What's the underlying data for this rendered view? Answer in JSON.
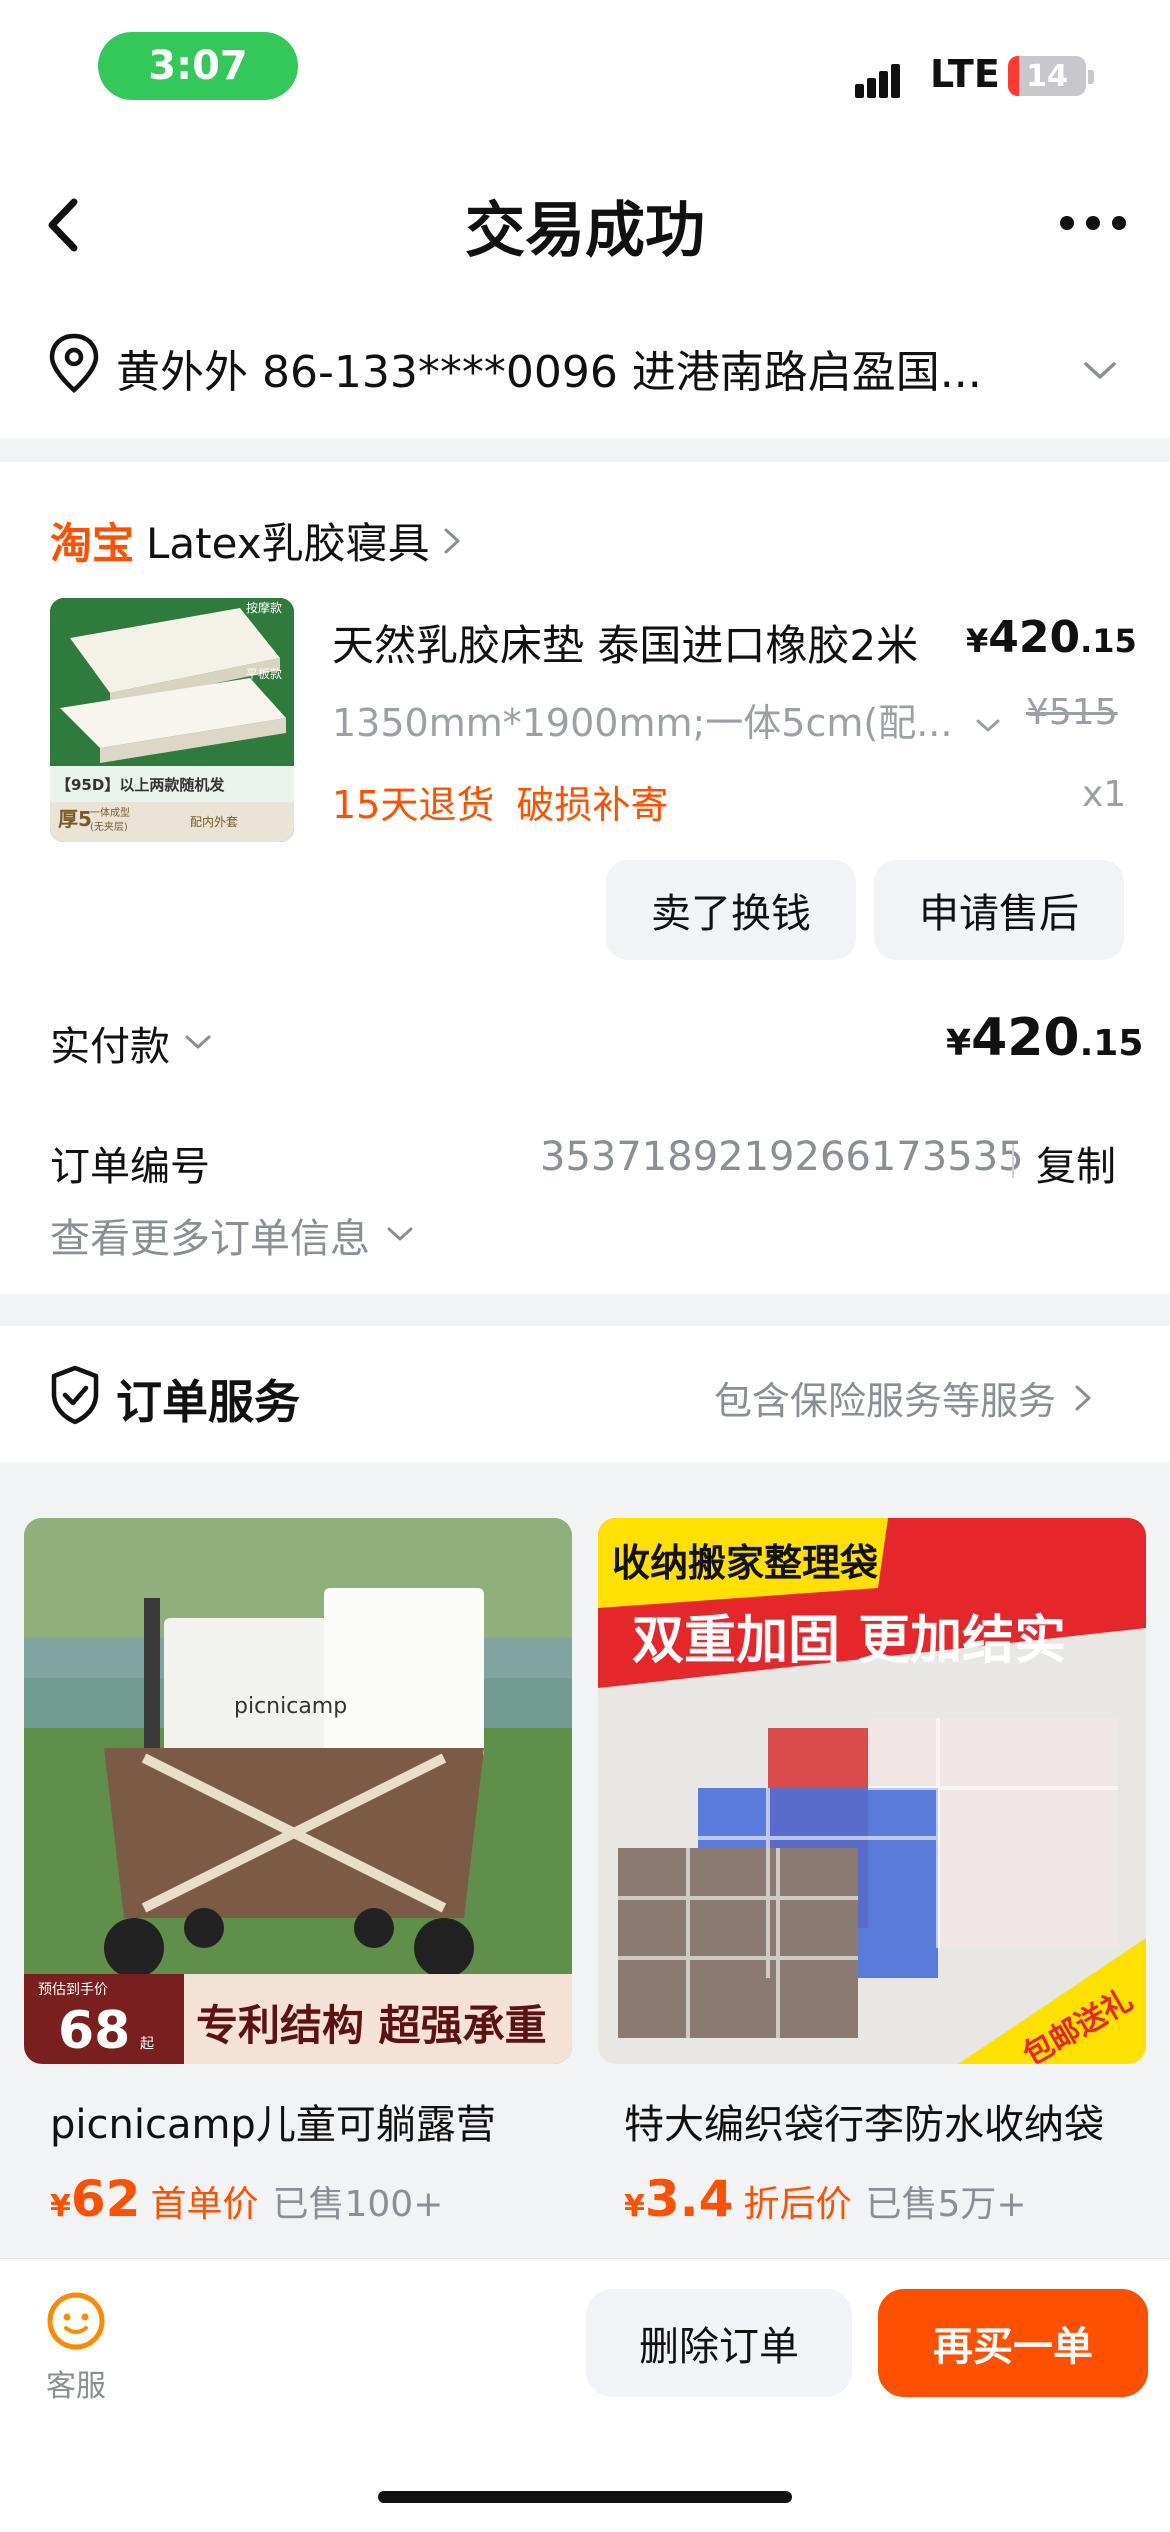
{
  "status": {
    "time": "3:07",
    "network": "LTE",
    "battery": "14",
    "battery_level": 0.14
  },
  "nav": {
    "title": "交易成功"
  },
  "address": {
    "text": "黄外外  86-133****0096  进港南路启盈国..."
  },
  "order": {
    "shop_brand": "淘宝",
    "shop_name": "Latex乳胶寝具",
    "product": {
      "title": "天然乳胶床垫 泰国进口橡胶2米",
      "price_yen": "¥",
      "price_int": "420",
      "price_dec": ".15",
      "spec": "1350mm*1900mm;一体5cm(配...",
      "original_price": "¥515",
      "tags": [
        "15天退货",
        "破损补寄"
      ],
      "qty": "x1",
      "thumb_text": {
        "tag1": "按摩款",
        "tag2": "平板款",
        "banner": "【95D】以上两款随机发",
        "note1": "厚5",
        "note2": "一体成型",
        "note3": "(无夹层)",
        "note4": "配内外套"
      }
    },
    "buttons": {
      "sell": "卖了换钱",
      "after_sale": "申请售后"
    },
    "paid_label": "实付款",
    "paid_yen": "¥",
    "paid_int": "420",
    "paid_dec": ".15",
    "order_no_label": "订单编号",
    "order_no": "3537189219266173535",
    "copy": "复制",
    "more_info": "查看更多订单信息"
  },
  "service": {
    "label": "订单服务",
    "summary": "包含保险服务等服务"
  },
  "recommend": [
    {
      "name": "picnicamp儿童可躺露营",
      "yen": "¥",
      "price": "62",
      "tag": "首单价",
      "sold": "已售100+",
      "img_text": {
        "price_note": "预估到手价",
        "price_big": "68",
        "price_unit": "起",
        "slogan": "专利结构 超强承重",
        "brand": "picnicamp"
      }
    },
    {
      "name": "特大编织袋行李防水收纳袋",
      "yen": "¥",
      "price": "3.4",
      "tag": "折后价",
      "sold": "已售5万+",
      "img_text": {
        "headline": "收纳搬家整理袋",
        "slogan": "双重加固 更加结实",
        "corner": "包邮送礼"
      }
    }
  ],
  "bottom": {
    "cs_label": "客服",
    "delete": "删除订单",
    "rebuy": "再买一单"
  },
  "colors": {
    "accent": "#ff5000",
    "green": "#34c759",
    "gray_text": "#8a8f96"
  }
}
